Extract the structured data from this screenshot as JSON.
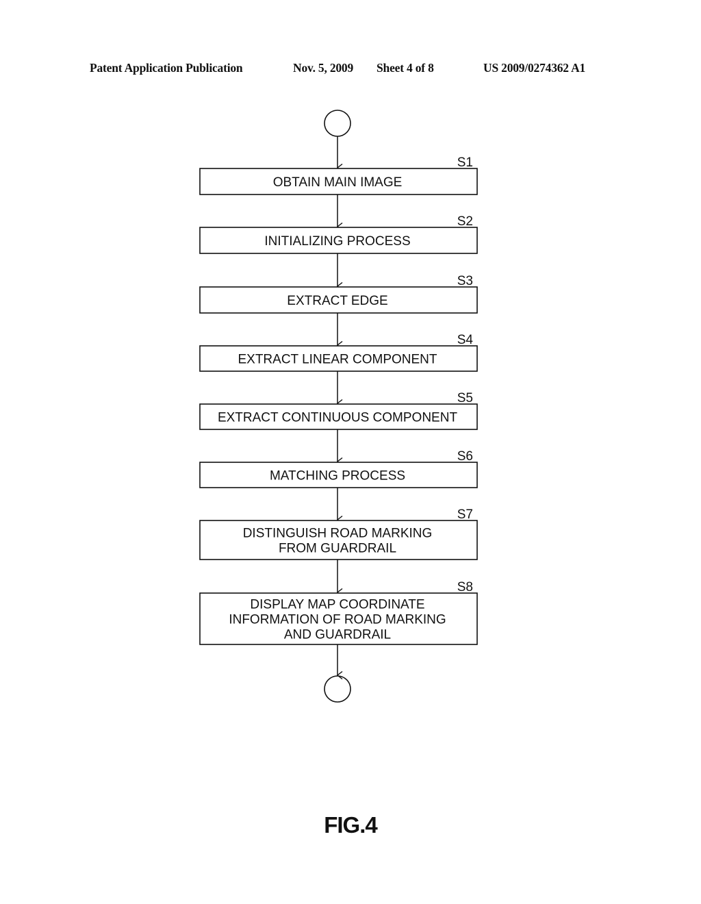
{
  "header": {
    "publication": "Patent Application Publication",
    "date": "Nov. 5, 2009",
    "sheet": "Sheet 4 of 8",
    "number": "US 2009/0274362 A1"
  },
  "flowchart": {
    "start_terminal": "start",
    "end_terminal": "end",
    "steps": [
      {
        "id": "S1",
        "lines": [
          "OBTAIN MAIN IMAGE"
        ]
      },
      {
        "id": "S2",
        "lines": [
          "INITIALIZING PROCESS"
        ]
      },
      {
        "id": "S3",
        "lines": [
          "EXTRACT EDGE"
        ]
      },
      {
        "id": "S4",
        "lines": [
          "EXTRACT LINEAR COMPONENT"
        ]
      },
      {
        "id": "S5",
        "lines": [
          "EXTRACT CONTINUOUS COMPONENT"
        ]
      },
      {
        "id": "S6",
        "lines": [
          "MATCHING PROCESS"
        ]
      },
      {
        "id": "S7",
        "lines": [
          "DISTINGUISH ROAD MARKING",
          "FROM GUARDRAIL"
        ]
      },
      {
        "id": "S8",
        "lines": [
          "DISPLAY MAP COORDINATE",
          "INFORMATION OF ROAD MARKING",
          "AND GUARDRAIL"
        ]
      }
    ]
  },
  "figure_label": "FIG.4"
}
